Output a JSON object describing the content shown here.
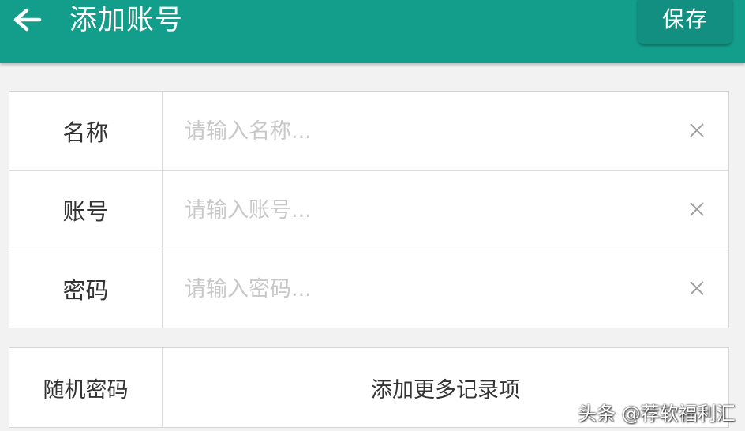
{
  "appbar": {
    "back_icon": "arrow-left-icon",
    "title": "添加账号",
    "save_label": "保存",
    "color": "#139e8c"
  },
  "form": {
    "rows": [
      {
        "label": "名称",
        "placeholder": "请输入名称...",
        "value": "",
        "clear_icon": "close-icon"
      },
      {
        "label": "账号",
        "placeholder": "请输入账号...",
        "value": "",
        "clear_icon": "close-icon"
      },
      {
        "label": "密码",
        "placeholder": "请输入密码...",
        "value": "",
        "clear_icon": "close-icon"
      }
    ]
  },
  "actions": {
    "random_password_label": "随机密码",
    "add_more_label": "添加更多记录项"
  },
  "watermark": {
    "text": "头条 @荐软福利汇"
  }
}
